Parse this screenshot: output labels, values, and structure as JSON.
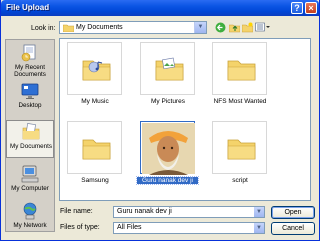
{
  "window": {
    "title": "File Upload"
  },
  "titlebar": {
    "help_glyph": "?",
    "close_glyph": "×"
  },
  "lookin": {
    "label": "Look in:",
    "value": "My Documents"
  },
  "places": [
    {
      "label": "My Recent Documents",
      "icon": "recent-documents-icon"
    },
    {
      "label": "Desktop",
      "icon": "desktop-icon"
    },
    {
      "label": "My Documents",
      "icon": "my-documents-icon",
      "active": true
    },
    {
      "label": "My Computer",
      "icon": "my-computer-icon"
    },
    {
      "label": "My Network",
      "icon": "my-network-icon"
    }
  ],
  "files": [
    {
      "label": "My Music",
      "icon": "music-folder-icon"
    },
    {
      "label": "My Pictures",
      "icon": "pictures-folder-icon"
    },
    {
      "label": "NFS Most Wanted",
      "icon": "folder-icon"
    },
    {
      "label": "Samsung",
      "icon": "folder-icon"
    },
    {
      "label": "Guru nanak dev ji",
      "icon": "image-thumbnail",
      "selected": true
    },
    {
      "label": "script",
      "icon": "folder-icon"
    }
  ],
  "filename": {
    "label": "File name:",
    "value": "Guru nanak dev ji"
  },
  "filetype": {
    "label": "Files of type:",
    "value": "All Files"
  },
  "buttons": {
    "open": "Open",
    "cancel": "Cancel"
  },
  "colors": {
    "titlebar": "#0a54e3",
    "selection": "#316ac5",
    "folder": "#f4d36b",
    "dialog_bg": "#ece9d8"
  }
}
